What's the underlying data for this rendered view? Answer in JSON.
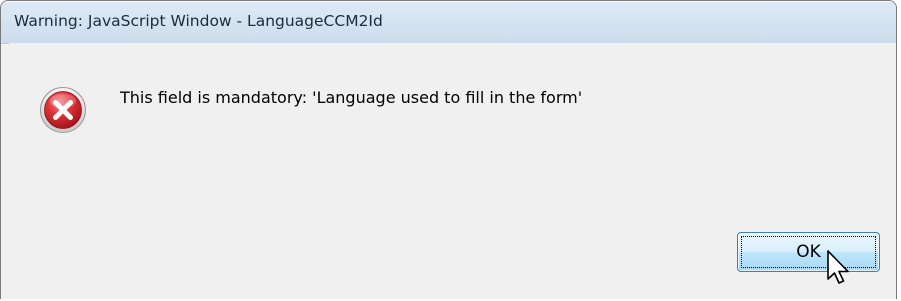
{
  "window": {
    "title": "Warning: JavaScript Window - LanguageCCM2Id"
  },
  "dialog": {
    "icon": "error-icon",
    "message": "This field is mandatory: 'Language used to fill in the form'",
    "ok_label": "OK"
  },
  "colors": {
    "title_bar": "#d6e4f2",
    "dialog_bg": "#f0f0f0",
    "error_red": "#d9262b",
    "button_border": "#3c7fb1"
  }
}
